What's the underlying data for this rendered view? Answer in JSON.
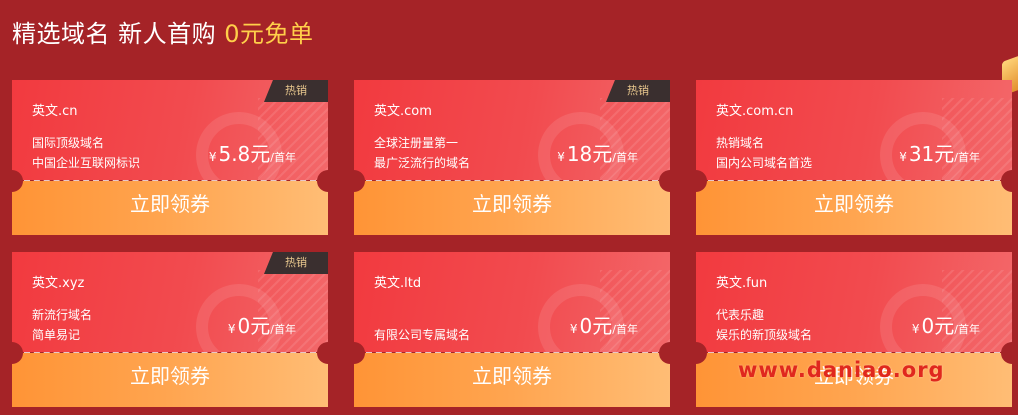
{
  "header": {
    "title": "精选域名 新人首购",
    "highlight": "0元免单"
  },
  "cards": [
    {
      "domain": "英文.cn",
      "tag": "热销",
      "desc1": "国际顶级域名",
      "desc2": "中国企业互联网标识",
      "currency": "¥",
      "price": "5.8元",
      "unit": "/首年",
      "button": "立即领券"
    },
    {
      "domain": "英文.com",
      "tag": "热销",
      "desc1": "全球注册量第一",
      "desc2": "最广泛流行的域名",
      "currency": "¥",
      "price": "18元",
      "unit": "/首年",
      "button": "立即领券"
    },
    {
      "domain": "英文.com.cn",
      "tag": "",
      "desc1": "热销域名",
      "desc2": "国内公司域名首选",
      "currency": "¥",
      "price": "31元",
      "unit": "/首年",
      "button": "立即领券"
    },
    {
      "domain": "英文.xyz",
      "tag": "热销",
      "desc1": "新流行域名",
      "desc2": "简单易记",
      "currency": "¥",
      "price": "0元",
      "unit": "/首年",
      "button": "立即领券"
    },
    {
      "domain": "英文.ltd",
      "tag": "",
      "desc1": "",
      "desc2": "有限公司专属域名",
      "currency": "¥",
      "price": "0元",
      "unit": "/首年",
      "button": "立即领券"
    },
    {
      "domain": "英文.fun",
      "tag": "",
      "desc1": "代表乐趣",
      "desc2": "娱乐的新顶级域名",
      "currency": "¥",
      "price": "0元",
      "unit": "/首年",
      "button": "立即领券"
    }
  ],
  "watermark": "www.daniao.org",
  "colors": {
    "background": "#a52327",
    "card_top": "#f23a3f",
    "button": "#ffa550",
    "highlight": "#ffcf4a",
    "tag_bg": "#3a2f2f",
    "tag_text": "#e9c88e"
  }
}
